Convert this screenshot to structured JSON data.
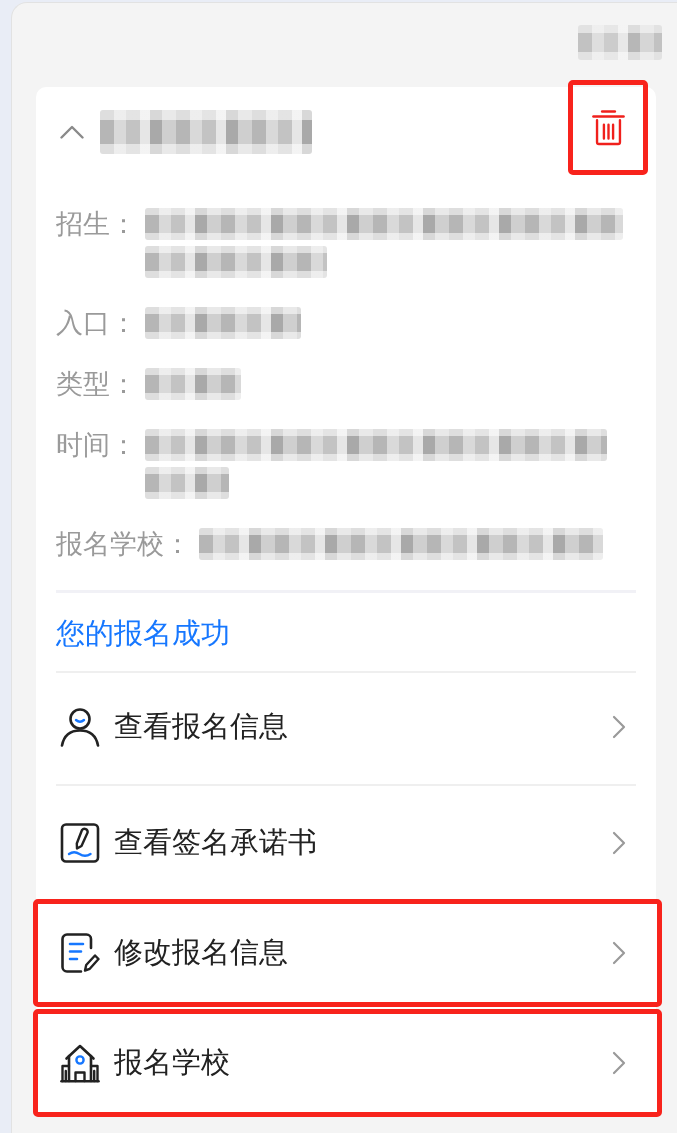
{
  "top_right_text": {
    "blurred": true
  },
  "card": {
    "expanded": true,
    "title": {
      "blurred": true
    },
    "delete_button": {
      "highlighted": true
    },
    "fields": [
      {
        "label": "招生：",
        "blurred": true
      },
      {
        "label": "入口：",
        "blurred": true
      },
      {
        "label": "类型：",
        "blurred": true
      },
      {
        "label": "时间：",
        "blurred": true
      },
      {
        "label": "报名学校：",
        "blurred": true
      }
    ],
    "status": "您的报名成功",
    "menu": [
      {
        "label": "查看报名信息",
        "highlighted": false
      },
      {
        "label": "查看签名承诺书",
        "highlighted": false
      },
      {
        "label": "修改报名信息",
        "highlighted": true
      },
      {
        "label": "报名学校",
        "highlighted": true
      }
    ]
  }
}
